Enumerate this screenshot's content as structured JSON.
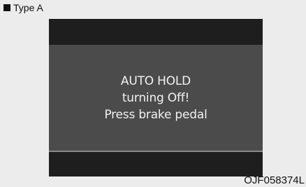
{
  "header": {
    "type_label": "Type A",
    "bullet_icon": "square-icon"
  },
  "display": {
    "lines": [
      "AUTO HOLD",
      "turning Off!",
      "Press brake pedal"
    ],
    "colors": {
      "frame": "#1e1e1e",
      "panel": "#4b4b4b",
      "text": "#f2f2f2",
      "page": "#ececec"
    }
  },
  "footer": {
    "figure_code": "OJF058374L"
  }
}
